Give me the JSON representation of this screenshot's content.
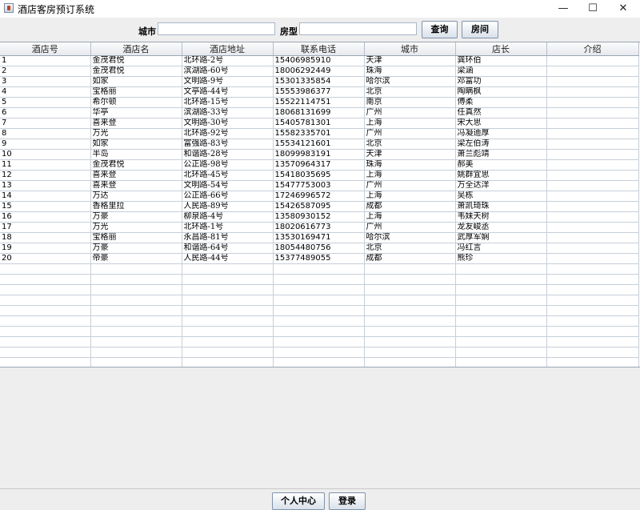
{
  "window": {
    "title": "酒店客房预订系统",
    "minimize": "—",
    "maximize": "☐",
    "close": "✕"
  },
  "search": {
    "city_label": "城市",
    "city_value": "",
    "room_type_label": "房型",
    "room_type_value": "",
    "query_button": "查询",
    "room_button": "房间"
  },
  "table": {
    "columns": [
      "酒店号",
      "酒店名",
      "酒店地址",
      "联系电话",
      "城市",
      "店长",
      "介绍"
    ],
    "rows": [
      [
        "1",
        "金茂君悦",
        "北环路-2号",
        "15406985910",
        "天津",
        "龚环伯",
        ""
      ],
      [
        "2",
        "金茂君悦",
        "滨湖路-60号",
        "18006292449",
        "珠海",
        "梁涵",
        ""
      ],
      [
        "3",
        "如家",
        "文明路-9号",
        "15301335854",
        "哈尔滨",
        "邓富功",
        ""
      ],
      [
        "4",
        "宝格丽",
        "文亭路-44号",
        "15553986377",
        "北京",
        "陶瞒枫",
        ""
      ],
      [
        "5",
        "希尔顿",
        "北环路-15号",
        "15522114751",
        "南京",
        "傅柔",
        ""
      ],
      [
        "6",
        "华亭",
        "滨湖路-33号",
        "18068131699",
        "广州",
        "任真然",
        ""
      ],
      [
        "7",
        "喜来登",
        "文明路-30号",
        "15405781301",
        "上海",
        "宋大思",
        ""
      ],
      [
        "8",
        "万光",
        "北环路-92号",
        "15582335701",
        "广州",
        "冯凝迪厚",
        ""
      ],
      [
        "9",
        "如家",
        "富强路-83号",
        "15534121601",
        "北京",
        "梁左伯涛",
        ""
      ],
      [
        "10",
        "半岛",
        "和谐路-28号",
        "18099983191",
        "天津",
        "萧兰彪靖",
        ""
      ],
      [
        "11",
        "金茂君悦",
        "公正路-98号",
        "13570964317",
        "珠海",
        "郝美",
        ""
      ],
      [
        "12",
        "喜来登",
        "北环路-45号",
        "15418035695",
        "上海",
        "姚群宜思",
        ""
      ],
      [
        "13",
        "喜来登",
        "文明路-54号",
        "15477753003",
        "广州",
        "万全达洋",
        ""
      ],
      [
        "14",
        "万达",
        "公正路-66号",
        "17246996572",
        "上海",
        "吴栋",
        ""
      ],
      [
        "15",
        "香格里拉",
        "人民路-89号",
        "15426587095",
        "成都",
        "萧凯琦珠",
        ""
      ],
      [
        "16",
        "万豪",
        "柳泉路-4号",
        "13580930152",
        "上海",
        "韦妹天树",
        ""
      ],
      [
        "17",
        "万光",
        "北环路-1号",
        "18020616773",
        "广州",
        "龙友峻丞",
        ""
      ],
      [
        "18",
        "宝格丽",
        "永昌路-81号",
        "13530169471",
        "哈尔滨",
        "武厚军娴",
        ""
      ],
      [
        "19",
        "万豪",
        "和谐路-64号",
        "18054480756",
        "北京",
        "冯红言",
        ""
      ],
      [
        "20",
        "帝豪",
        "人民路-44号",
        "15377489055",
        "成都",
        "熊珍",
        ""
      ]
    ]
  },
  "footer": {
    "personal_button": "个人中心",
    "login_button": "登录"
  }
}
